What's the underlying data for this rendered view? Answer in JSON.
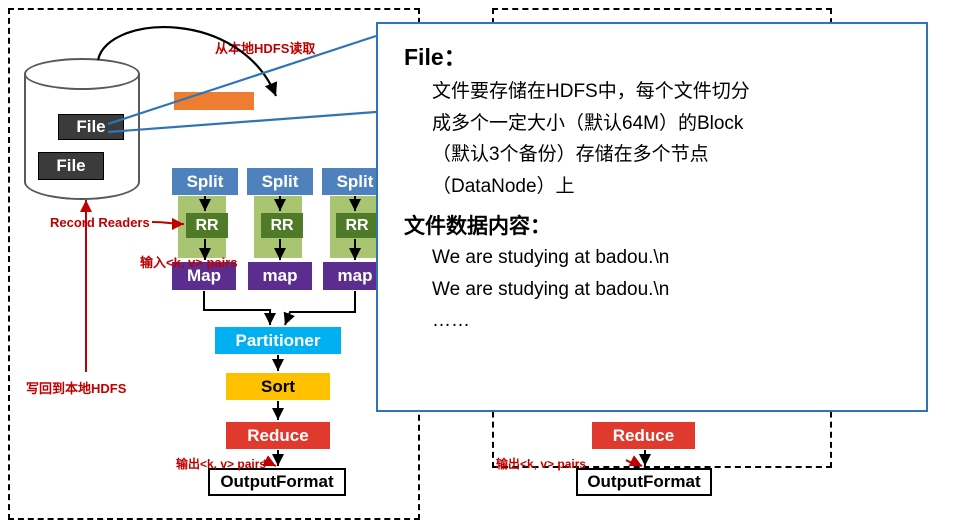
{
  "diagram": {
    "title_hidden": "",
    "left_flow": {
      "file_top_label": "File",
      "file_bottom_label": "File",
      "splits": [
        "Split",
        "Split",
        "Split"
      ],
      "record_readers": [
        "RR",
        "RR",
        "RR"
      ],
      "maps": [
        "Map",
        "map",
        "map"
      ],
      "partitioner": "Partitioner",
      "sort": "Sort",
      "reduce": "Reduce",
      "outputformat": "OutputFormat"
    },
    "right_flow": {
      "reduce": "Reduce",
      "outputformat": "OutputFormat"
    },
    "annotations": {
      "read_from_hdfs": "从本地HDFS读取",
      "record_readers": "Record Readers",
      "input_pairs": "输入<k, v> pairs",
      "write_back_hdfs": "写回到本地HDFS",
      "output_pairs_left": "输出<k, v> pairs",
      "output_pairs_right": "输出<k, v> pairs"
    }
  },
  "callout": {
    "heading": "File：",
    "lines": [
      "文件要存储在HDFS中，每个文件切分",
      "成多个一定大小（默认64M）的Block",
      "（默认3个备份）存储在多个节点",
      "（DataNode）上"
    ],
    "subheading": "文件数据内容：",
    "content_lines": [
      "We are studying at badou.\\n",
      "We are studying at badou.\\n",
      "……"
    ]
  },
  "colors": {
    "split": "#4f81bd",
    "rr": "#4f7a28",
    "map": "#5b2d8e",
    "partitioner": "#00b0f0",
    "sort": "#ffc000",
    "reduce": "#e03a2f",
    "callout_border": "#2e75b6",
    "annotation_red": "#c00000",
    "orange_bar": "#ed7d31",
    "green_bar": "#9bbb59"
  }
}
